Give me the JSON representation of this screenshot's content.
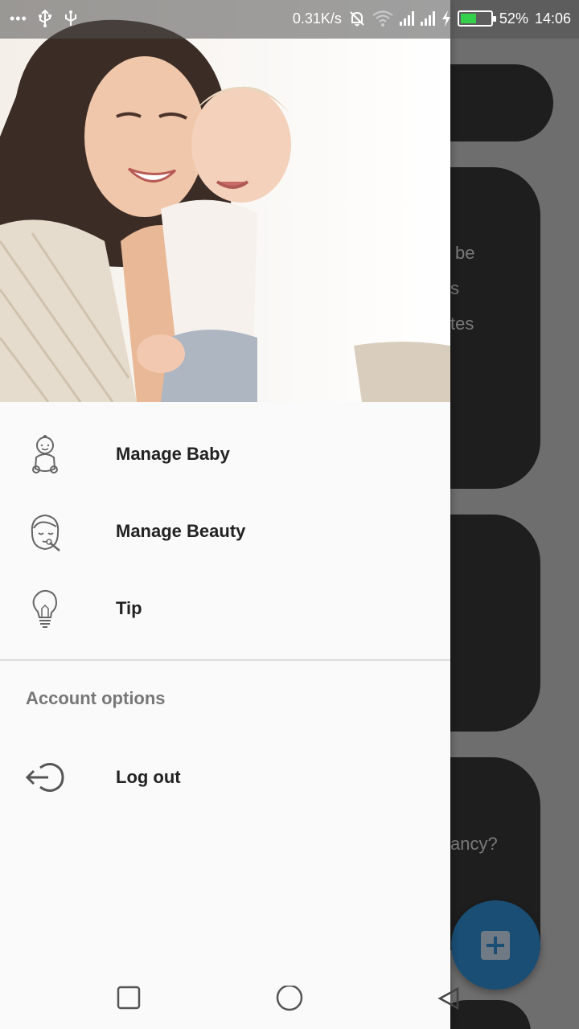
{
  "status_bar": {
    "net_speed": "0.31K/s",
    "battery_percent": "52%",
    "battery_level": 0.52,
    "time": "14:06"
  },
  "drawer": {
    "menu_items": [
      {
        "label": "Manage Baby",
        "icon": "baby-icon"
      },
      {
        "label": "Manage Beauty",
        "icon": "beauty-face-icon"
      },
      {
        "label": "Tip",
        "icon": "lightbulb-icon"
      }
    ],
    "account_section": {
      "header": "Account options",
      "items": [
        {
          "label": "Log out",
          "icon": "logout-icon"
        }
      ]
    }
  },
  "background_fragments": [
    "be",
    "s",
    "tes",
    "ancy?"
  ],
  "colors": {
    "drawer_bg": "#fafafa",
    "scrim": "#6e6e6e",
    "fab": "#1a4e74",
    "battery_fill": "#35d04b"
  }
}
